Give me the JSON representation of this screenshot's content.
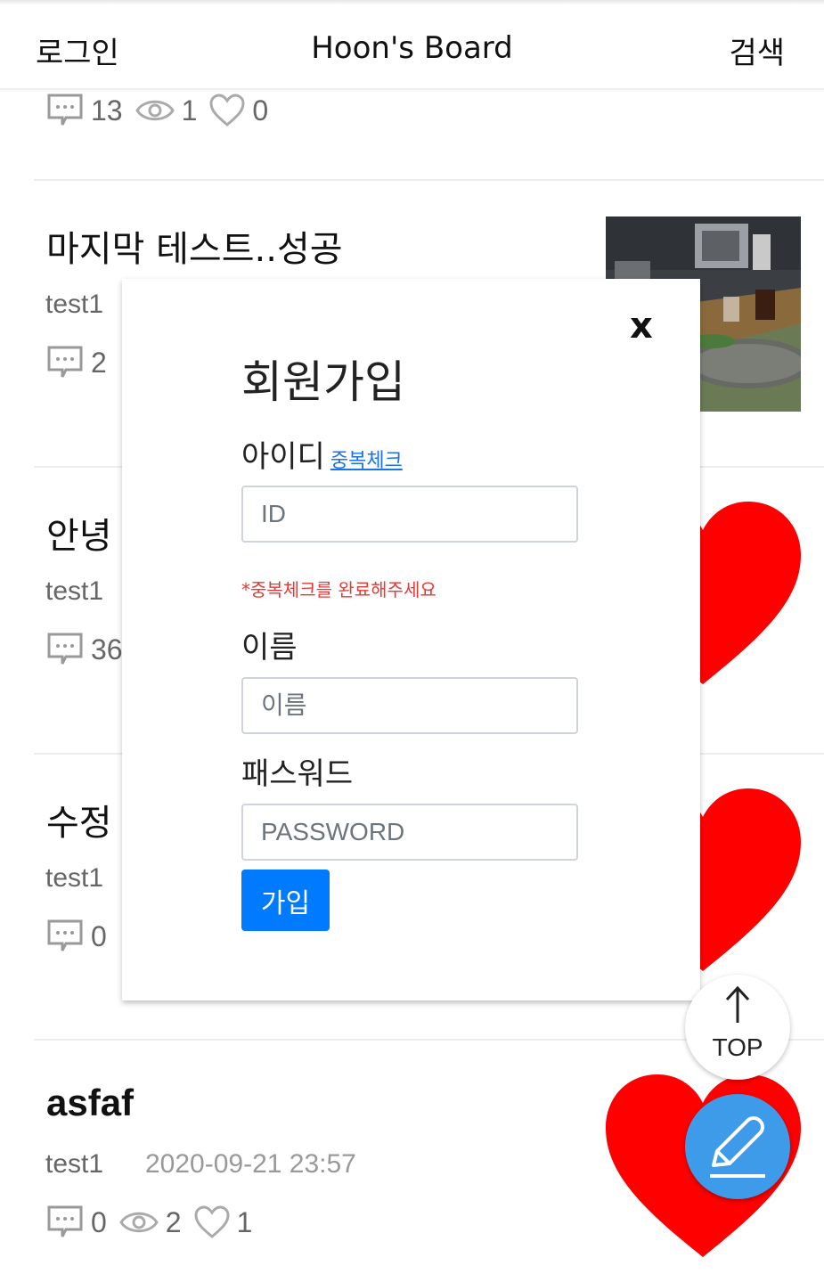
{
  "header": {
    "login": "로그인",
    "title": "Hoon's Board",
    "search": "검색"
  },
  "posts": [
    {
      "title": "",
      "author": "",
      "date": "",
      "comments": "13",
      "views": "1",
      "likes": "0"
    },
    {
      "title": "마지막 테스트..성공",
      "author": "test1",
      "date": "",
      "comments": "2",
      "views": "",
      "likes": ""
    },
    {
      "title": "안녕",
      "author": "test1",
      "date": "",
      "comments": "36",
      "views": "",
      "likes": ""
    },
    {
      "title": "수정",
      "author": "test1",
      "date": "",
      "comments": "0",
      "views": "",
      "likes": ""
    },
    {
      "title": "asfaf",
      "author": "test1",
      "date": "2020-09-21 23:57",
      "comments": "0",
      "views": "2",
      "likes": "1"
    }
  ],
  "modal": {
    "close": "x",
    "title": "회원가입",
    "id_label": "아이디",
    "dup_check": "중복체크",
    "id_placeholder": "ID",
    "warning": "*중복체크를 완료해주세요",
    "name_label": "이름",
    "name_placeholder": "이름",
    "password_label": "패스워드",
    "password_placeholder": "PASSWORD",
    "submit": "가입"
  },
  "floating": {
    "top_label": "TOP"
  },
  "colors": {
    "primary_button": "#007bff",
    "heart": "#ff0000",
    "write_button": "#3d9be9",
    "warning": "#e53935"
  }
}
